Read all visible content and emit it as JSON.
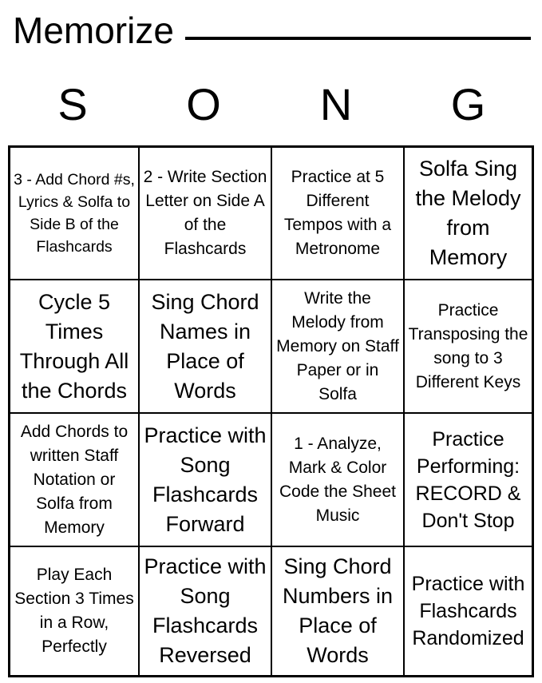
{
  "header": {
    "title": "Memorize",
    "blank_line": "",
    "column_letters": [
      "S",
      "O",
      "N",
      "G"
    ]
  },
  "card": {
    "columns": [
      "S",
      "O",
      "N",
      "G"
    ],
    "rows": [
      [
        {
          "text": "3 - Add Chord #s, Lyrics & Solfa to Side B of the Flashcards",
          "size": "fs-sm"
        },
        {
          "text": "2 - Write Section Letter on Side A of the Flashcards",
          "size": "fs-md"
        },
        {
          "text": "Practice at 5 Different Tempos with a Metronome",
          "size": "fs-md"
        },
        {
          "text": "Solfa Sing the Melody from Memory",
          "size": "fs-xl"
        }
      ],
      [
        {
          "text": "Cycle 5 Times Through All the Chords",
          "size": "fs-xl"
        },
        {
          "text": "Sing Chord Names in Place of Words",
          "size": "fs-xl"
        },
        {
          "text": "Write the Melody from Memory on Staff Paper or in Solfa",
          "size": "fs-md"
        },
        {
          "text": "Practice Transposing the song to 3 Different Keys",
          "size": "fs-md"
        }
      ],
      [
        {
          "text": "Add Chords to written Staff Notation or Solfa from Memory",
          "size": "fs-md"
        },
        {
          "text": "Practice with Song Flashcards Forward",
          "size": "fs-xl"
        },
        {
          "text": "1 - Analyze, Mark & Color Code the Sheet Music",
          "size": "fs-md"
        },
        {
          "text": "Practice Performing: RECORD & Don't Stop",
          "size": "fs-lg"
        }
      ],
      [
        {
          "text": "Play Each Section 3 Times in a Row, Perfectly",
          "size": "fs-md"
        },
        {
          "text": "Practice with Song Flashcards Reversed",
          "size": "fs-xl"
        },
        {
          "text": "Sing Chord Numbers in Place of Words",
          "size": "fs-xl"
        },
        {
          "text": "Practice with Flashcards Randomized",
          "size": "fs-lg"
        }
      ]
    ]
  },
  "colors": {
    "background": "#ffffff",
    "text": "#000000",
    "border": "#000000"
  }
}
